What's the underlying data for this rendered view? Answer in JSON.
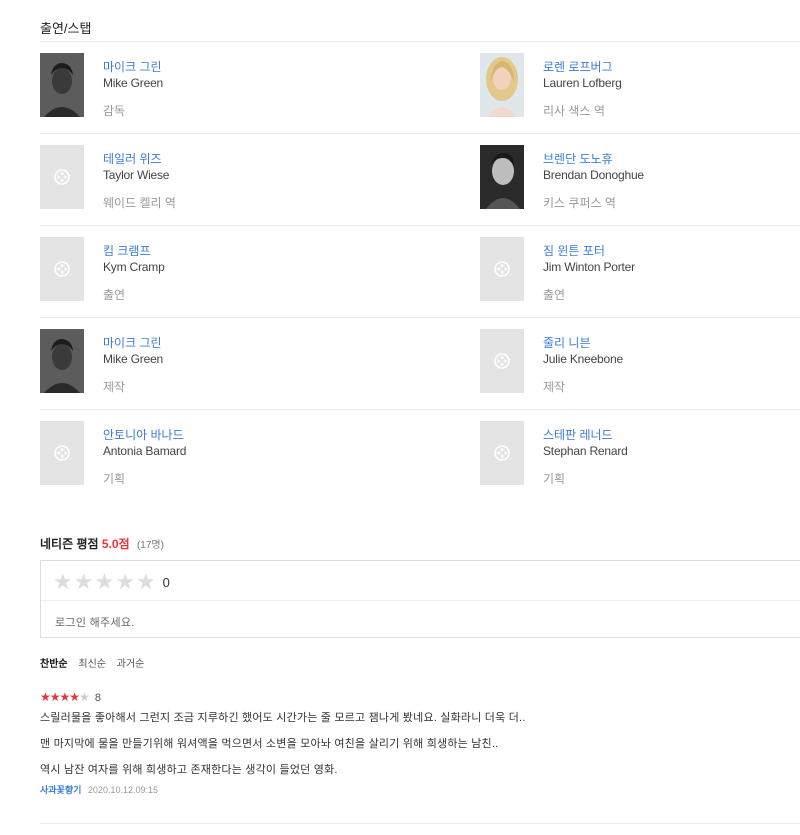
{
  "cast_section": {
    "title": "출연/스탭",
    "rows": [
      [
        {
          "kname": "마이크 그린",
          "ename": "Mike Green",
          "role": "감독",
          "photo": "male-dark-portrait"
        },
        {
          "kname": "로렌 로프버그",
          "ename": "Lauren Lofberg",
          "role": "리사 색스 역",
          "photo": "female-blonde-portrait"
        }
      ],
      [
        {
          "kname": "테일러 위즈",
          "ename": "Taylor Wiese",
          "role": "웨이드 켈리 역",
          "photo": "placeholder-film-icon"
        },
        {
          "kname": "브렌단 도노휴",
          "ename": "Brendan Donoghue",
          "role": "키스 쿠퍼스 역",
          "photo": "male-bw-portrait"
        }
      ],
      [
        {
          "kname": "킴 크램프",
          "ename": "Kym Cramp",
          "role": "출연",
          "photo": "placeholder-film-icon"
        },
        {
          "kname": "짐 윈튼 포터",
          "ename": "Jim Winton Porter",
          "role": "출연",
          "photo": "placeholder-film-icon"
        }
      ],
      [
        {
          "kname": "마이크 그린",
          "ename": "Mike Green",
          "role": "제작",
          "photo": "male-dark-portrait"
        },
        {
          "kname": "줄리 니븐",
          "ename": "Julie Kneebone",
          "role": "제작",
          "photo": "placeholder-film-icon"
        }
      ],
      [
        {
          "kname": "안토니아 바나드",
          "ename": "Antonia Bamard",
          "role": "기획",
          "photo": "placeholder-film-icon"
        },
        {
          "kname": "스테판 레너드",
          "ename": "Stephan Renard",
          "role": "기획",
          "photo": "placeholder-film-icon"
        }
      ]
    ]
  },
  "netizen_rating": {
    "label": "네티즌 평점",
    "score": "5.0점",
    "count": "(17명)",
    "my_score": "0",
    "login_prompt": "로그인 해주세요.",
    "star_icon": "star-icon"
  },
  "sort_options": [
    {
      "label": "찬반순",
      "active": true
    },
    {
      "label": "최신순",
      "active": false
    },
    {
      "label": "과거순",
      "active": false
    }
  ],
  "review": {
    "stars_filled": 4,
    "stars_total": 5,
    "score": "8",
    "lines": [
      "스릴러물을 좋아해서 그런지 조금 지루하긴 했어도 시간가는 줄 모르고 잼나게 봤네요. 실화라니 더욱 더..",
      "맨 마지막에 물을 만들기위해 워셔액을 먹으면서 소변을 모아놔 여친을 살리기 위해 희생하는 남친..",
      "역시 남잔  여자를 위해 희생하고 존재한다는 생각이 들었던 영화."
    ],
    "user": "사과꽃향기",
    "date": "2020.10.12.09:15"
  },
  "colors": {
    "link_blue": "#3a7dd2",
    "score_red": "#e8323c",
    "placeholder_gray": "#e4e4e4"
  }
}
